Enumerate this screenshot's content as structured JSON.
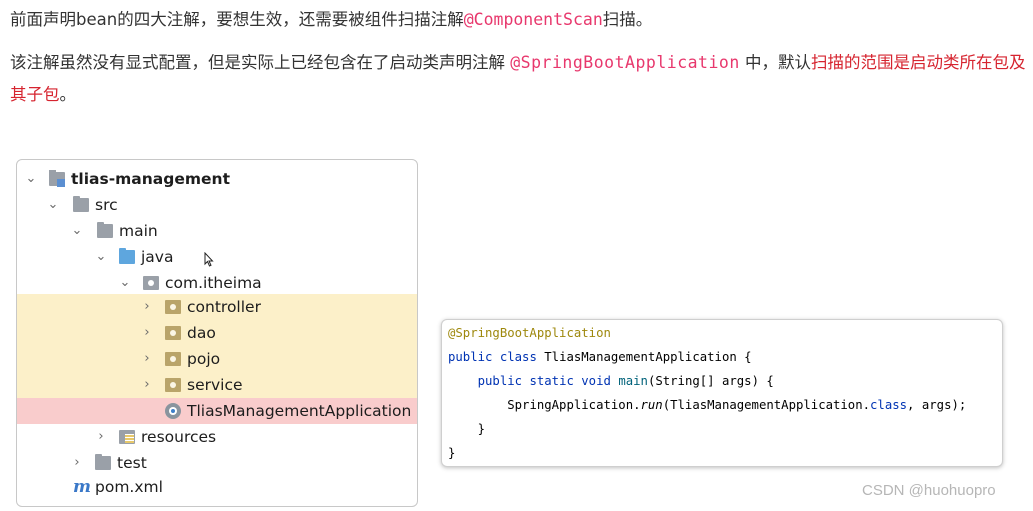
{
  "paragraph1": {
    "text_before": "前面声明bean的四大注解，要想生效，还需要被组件扫描注解",
    "annotation": "@ComponentScan",
    "text_after": "扫描。"
  },
  "paragraph2": {
    "text_before": "该注解虽然没有显式配置，但是实际上已经包含在了启动类声明注解 ",
    "annotation": "@SpringBootApplication",
    "text_middle": " 中，默认",
    "highlight": "扫描的范围是启动类所在包及其子包",
    "text_after": "。"
  },
  "tree": {
    "project": "tlias-management",
    "src": "src",
    "main": "main",
    "java": "java",
    "package": "com.itheima",
    "controller": "controller",
    "dao": "dao",
    "pojo": "pojo",
    "service": "service",
    "app_class": "TliasManagementApplication",
    "resources": "resources",
    "test": "test",
    "pom": "pom.xml",
    "pom_icon_glyph": "m"
  },
  "code": {
    "annotation": "@SpringBootApplication",
    "kw_public": "public",
    "kw_class": "class",
    "class_name": "TliasManagementApplication {",
    "kw_static": "static",
    "kw_void": "void",
    "main_name": "main",
    "main_args": "(String[] args) {",
    "call_prefix": "SpringApplication.",
    "call_method": "run",
    "call_arg_prefix": "(TliasManagementApplication.",
    "kw_class_ref": "class",
    "call_suffix": ", args);",
    "close_inner": "}",
    "close_outer": "}"
  },
  "watermark": "CSDN @huohuopro",
  "icons": {
    "chevron_down": "chevron-down-icon",
    "chevron_right": "chevron-right-icon",
    "folder": "folder-icon",
    "package": "package-icon",
    "class": "spring-boot-class-icon",
    "maven": "maven-icon",
    "cursor": "mouse-cursor-icon"
  },
  "colors": {
    "annotation_pink": "#e8386d",
    "highlight_red": "#d6242f",
    "row_yellow": "#fcf0c9",
    "row_red": "#f9cccc",
    "keyword_blue": "#0033b3",
    "annotation_olive": "#9e880d"
  }
}
